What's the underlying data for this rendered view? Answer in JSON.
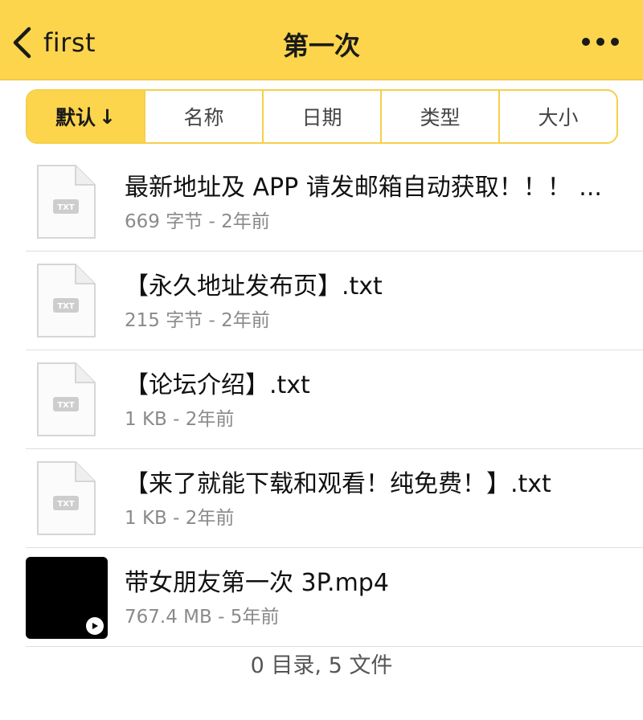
{
  "navbar": {
    "back_label": "first",
    "title": "第一次",
    "back_icon": "chevron-left-icon",
    "more_icon": "more-horizontal-icon"
  },
  "sort": {
    "tabs": [
      {
        "label": "默认",
        "arrow": "↓",
        "active": true
      },
      {
        "label": "名称",
        "arrow": "",
        "active": false
      },
      {
        "label": "日期",
        "arrow": "",
        "active": false
      },
      {
        "label": "类型",
        "arrow": "",
        "active": false
      },
      {
        "label": "大小",
        "arrow": "",
        "active": false
      }
    ]
  },
  "files": [
    {
      "name": "最新地址及 APP 请发邮箱自动获取！！！ ...",
      "meta": "669 字节 - 2年前",
      "icon": "txt-file-icon",
      "badge": "TXT"
    },
    {
      "name": "【永久地址发布页】.txt",
      "meta": "215 字节 - 2年前",
      "icon": "txt-file-icon",
      "badge": "TXT"
    },
    {
      "name": "【论坛介绍】.txt",
      "meta": "1 KB - 2年前",
      "icon": "txt-file-icon",
      "badge": "TXT"
    },
    {
      "name": "【来了就能下载和观看！纯免费！】.txt",
      "meta": "1 KB - 2年前",
      "icon": "txt-file-icon",
      "badge": "TXT"
    },
    {
      "name": "带女朋友第一次 3P.mp4",
      "meta": "767.4 MB - 5年前",
      "icon": "video-thumbnail-icon"
    }
  ],
  "footer": {
    "summary": "0 目录, 5 文件"
  },
  "colors": {
    "accent": "#fcd54c",
    "border": "#f6cf4a"
  }
}
